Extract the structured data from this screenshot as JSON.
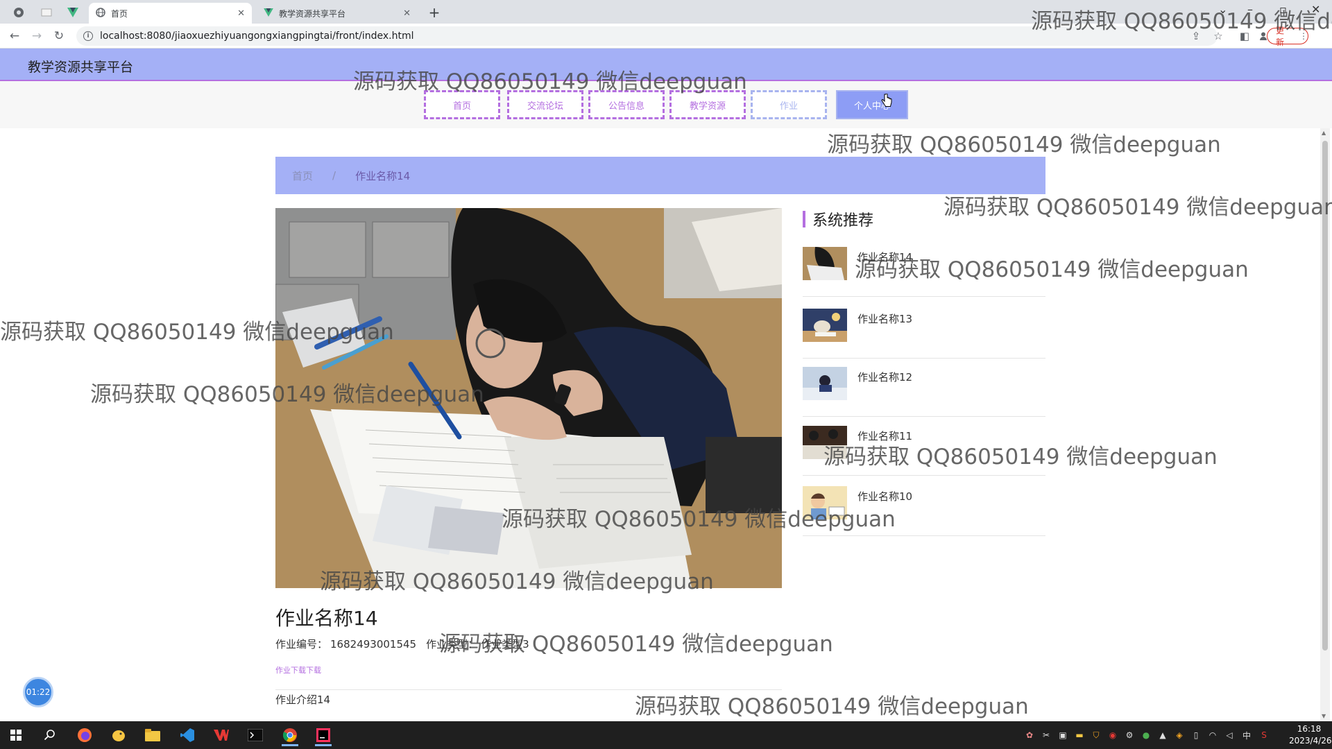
{
  "browser": {
    "tabs": [
      {
        "title": "首页",
        "active": true
      },
      {
        "title": "教学资源共享平台",
        "active": false
      }
    ],
    "url": "localhost:8080/jiaoxuezhiyuangongxiangpingtai/front/index.html",
    "update_label": "更新"
  },
  "site": {
    "title": "教学资源共享平台",
    "nav": [
      "首页",
      "交流论坛",
      "公告信息",
      "教学资源",
      "作业",
      "个人中心"
    ],
    "active_nav_label": "个人中心"
  },
  "breadcrumb": {
    "home": "首页",
    "separator": "/",
    "current": "作业名称14"
  },
  "recommend": {
    "title": "系统推荐",
    "items": [
      "作业名称14",
      "作业名称13",
      "作业名称12",
      "作业名称11",
      "作业名称10"
    ]
  },
  "detail": {
    "title": "作业名称14",
    "number_label": "作业编号：",
    "number_value": "1682493001545",
    "type_label": "作业类型：",
    "type_value": "作业类型3",
    "download": "作业下载下载",
    "intro": "作业介绍14"
  },
  "timer": "01:22",
  "watermark": "源码获取 QQ86050149 微信deepguan",
  "taskbar": {
    "time": "16:18",
    "date": "2023/4/26",
    "ime": "中"
  },
  "colors": {
    "accent": "#b46fe0",
    "header_bg": "#a4b0f6",
    "active_nav": "#8d9df5"
  }
}
